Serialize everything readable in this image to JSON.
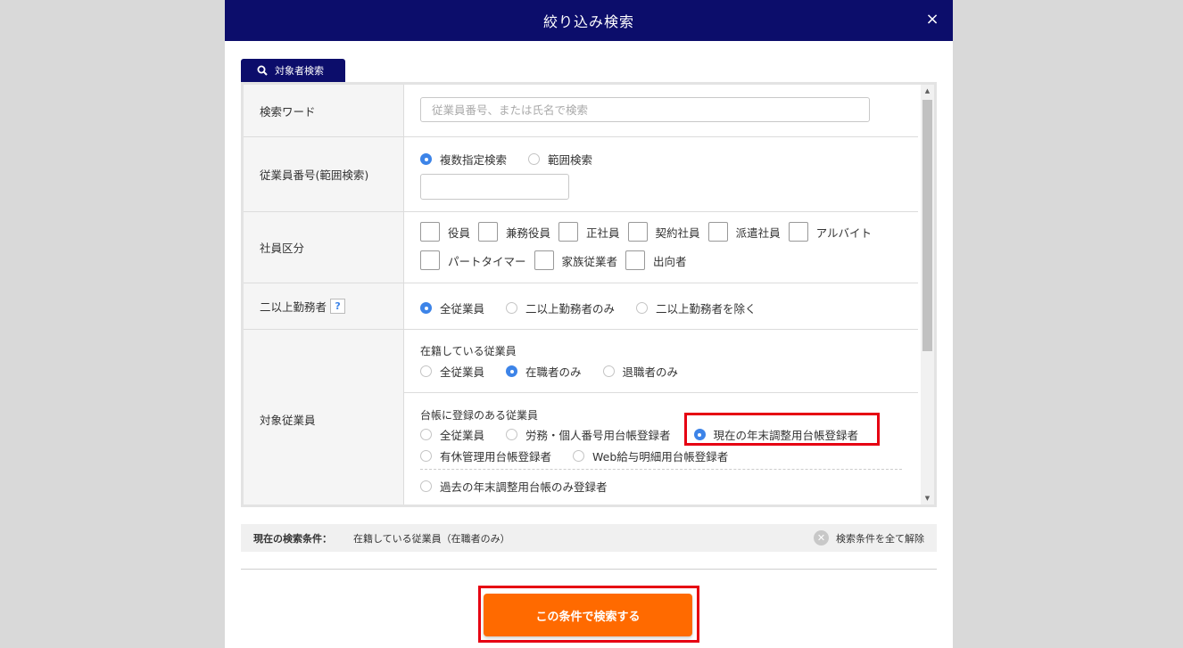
{
  "modal": {
    "title": "絞り込み検索",
    "close_label": "×"
  },
  "tab": {
    "label": "対象者検索"
  },
  "rows": {
    "keyword": {
      "label": "検索ワード",
      "placeholder": "従業員番号、または氏名で検索"
    },
    "employee_number": {
      "label": "従業員番号(範囲検索)",
      "options": [
        {
          "label": "複数指定検索",
          "checked": true
        },
        {
          "label": "範囲検索",
          "checked": false
        }
      ],
      "value": ""
    },
    "employee_type": {
      "label": "社員区分",
      "checkboxes": [
        "役員",
        "兼務役員",
        "正社員",
        "契約社員",
        "派遣社員",
        "アルバイト",
        "パートタイマー",
        "家族従業者",
        "出向者"
      ]
    },
    "multi_office": {
      "label": "二以上勤務者",
      "help": "?",
      "options": [
        {
          "label": "全従業員",
          "checked": true
        },
        {
          "label": "二以上勤務者のみ",
          "checked": false
        },
        {
          "label": "二以上勤務者を除く",
          "checked": false
        }
      ]
    },
    "target": {
      "label": "対象従業員",
      "enrolled": {
        "title": "在籍している従業員",
        "options": [
          {
            "label": "全従業員",
            "checked": false
          },
          {
            "label": "在職者のみ",
            "checked": true
          },
          {
            "label": "退職者のみ",
            "checked": false
          }
        ]
      },
      "ledger": {
        "title": "台帳に登録のある従業員",
        "options": [
          {
            "label": "全従業員",
            "checked": false
          },
          {
            "label": "労務・個人番号用台帳登録者",
            "checked": false
          },
          {
            "label": "現在の年末調整用台帳登録者",
            "checked": true
          },
          {
            "label": "有休管理用台帳登録者",
            "checked": false
          },
          {
            "label": "Web給与明細用台帳登録者",
            "checked": false
          },
          {
            "label": "過去の年末調整用台帳のみ登録者",
            "checked": false
          }
        ]
      }
    }
  },
  "conditions": {
    "label": "現在の検索条件：",
    "text": "在籍している従業員（在職者のみ）",
    "clear_label": "検索条件を全て解除"
  },
  "search_button": {
    "label": "この条件で検索する"
  },
  "colors": {
    "header": "#0c0d6b",
    "accent": "#3d84e8",
    "button": "#ff6a00",
    "highlight": "#e60012"
  },
  "icons": {
    "search": "search-icon",
    "close": "close-icon",
    "clear": "clear-circle-icon"
  }
}
